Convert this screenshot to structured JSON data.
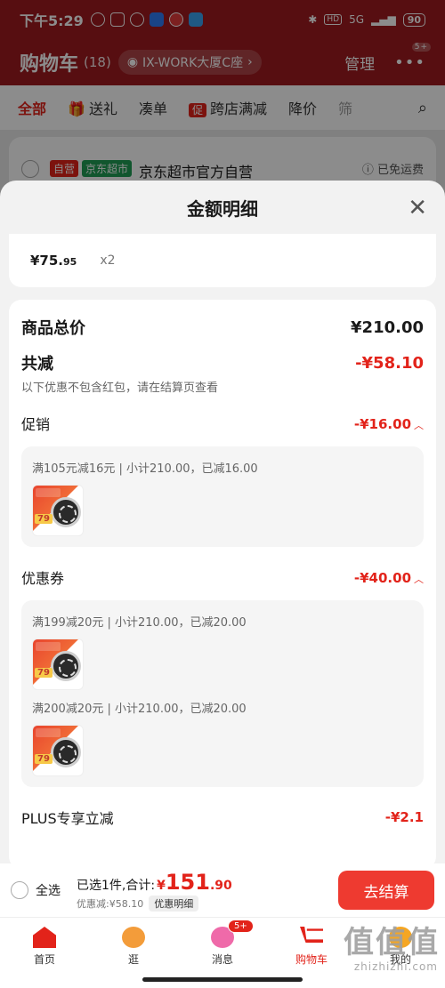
{
  "status": {
    "time": "下午5:29",
    "network": "5G",
    "battery": "90"
  },
  "header": {
    "title": "购物车",
    "count": "(18)",
    "address": "IX-WORK大厦C座",
    "manage": "管理",
    "more_badge": "5+"
  },
  "tabs": {
    "all": "全部",
    "gift": "送礼",
    "combine": "凑单",
    "cu_tag": "促",
    "cross_store": "跨店满减",
    "price_drop": "降价",
    "partial": "筛"
  },
  "store": {
    "self_tag": "自营",
    "mart_tag": "京东超市",
    "name": "京东超市官方自营",
    "free_ship": "已免运费"
  },
  "sheet": {
    "title": "金额明细",
    "item_price_int": "¥75.",
    "item_price_dec": "95",
    "item_qty": "x2",
    "total_label": "商品总价",
    "total_value": "¥210.00",
    "reduce_label": "共减",
    "reduce_value": "-¥58.10",
    "note": "以下优惠不包含红包，请在结算页查看",
    "promo_label": "促销",
    "promo_value": "-¥16.00",
    "promo_line": "满105元减16元 | 小计210.00，已减16.00",
    "coupon_label": "优惠券",
    "coupon_value": "-¥40.00",
    "coupon_line1": "满199减20元 | 小计210.00，已减20.00",
    "coupon_line2": "满200减20元 | 小计210.00，已减20.00",
    "plus_label": "PLUS专享立减",
    "plus_value": "-¥2.1",
    "thumb_price": "79"
  },
  "checkout": {
    "select_all": "全选",
    "selected_text": "已选1件,合计:",
    "currency": "¥",
    "total_int": "151",
    "total_dec": ".90",
    "discount_text": "优惠减:¥58.10",
    "detail_chip": "优惠明细",
    "button": "去结算"
  },
  "nav": {
    "home": "首页",
    "guang": "逛",
    "msg": "消息",
    "msg_badge": "5+",
    "cart": "购物车",
    "me": "我的"
  },
  "watermark": {
    "main": "值值值",
    "sub": "zhizhizhi.com"
  }
}
